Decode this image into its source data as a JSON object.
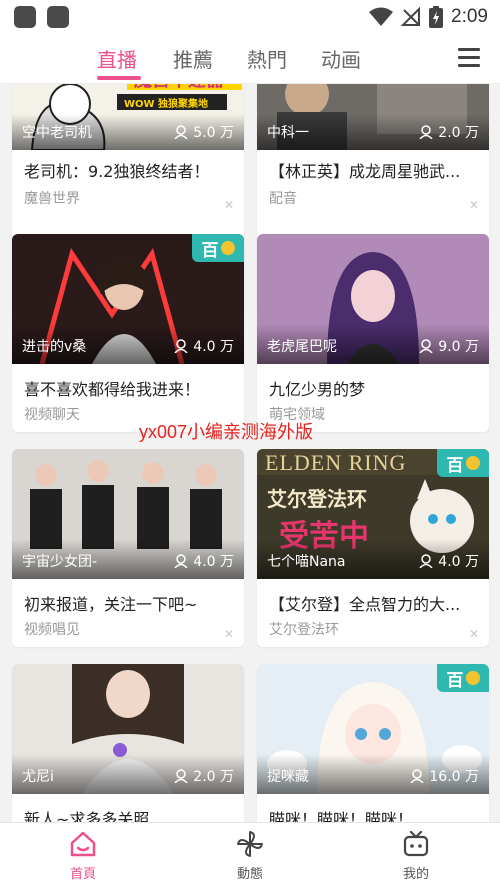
{
  "status_bar": {
    "time": "2:09"
  },
  "tabs": [
    {
      "label": "直播",
      "active": true
    },
    {
      "label": "推薦",
      "active": false
    },
    {
      "label": "熱門",
      "active": false
    },
    {
      "label": "动画",
      "active": false
    }
  ],
  "icons": {
    "menu": "menu-icon",
    "wifi": "wifi-icon",
    "signal": "no-signal-icon",
    "battery": "battery-charging-icon",
    "viewers": "person-icon",
    "close": "close-icon"
  },
  "colors": {
    "accent": "#ee4f8d",
    "badge": "#2fb8b0",
    "watermark": "#e8231d"
  },
  "cards": [
    {
      "streamer": "空中老司机",
      "viewers": "5.0 万",
      "title": "老司机：9.2独狼终结者！",
      "category": "魔兽世界",
      "badge": "",
      "overlay_text": "魔兽不速器",
      "overlay_sub": "WOW 独狼聚集地"
    },
    {
      "streamer": "中科一",
      "viewers": "2.0 万",
      "title": "【林正英】成龙周星驰武...",
      "category": "配音",
      "badge": ""
    },
    {
      "streamer": "进击的v桑",
      "viewers": "4.0 万",
      "title": "喜不喜欢都得给我进来！",
      "category": "视频聊天",
      "badge": "百"
    },
    {
      "streamer": "老虎尾巴呢",
      "viewers": "9.0 万",
      "title": "九亿少男的梦",
      "category": "萌宅领域",
      "badge": ""
    },
    {
      "streamer": "宇宙少女团-",
      "viewers": "4.0 万",
      "title": "初来报道，关注一下吧~",
      "category": "视频唱见",
      "badge": ""
    },
    {
      "streamer": "七个喵Nana",
      "viewers": "4.0 万",
      "title": "【艾尔登】全点智力的大...",
      "category": "艾尔登法环",
      "badge": "百",
      "overlay_text": "ELDEN RING",
      "overlay_sub": "艾尔登法环",
      "overlay_sub2": "受苦中"
    },
    {
      "streamer": "尤尼i",
      "viewers": "2.0 万",
      "title": "新人~求多多关照",
      "category": "",
      "badge": ""
    },
    {
      "streamer": "捉咪藏",
      "viewers": "16.0 万",
      "title": "瞄咪！瞄咪！瞄咪！",
      "category": "",
      "badge": "百"
    }
  ],
  "watermark": "yx007小编亲测海外版",
  "bottom_nav": [
    {
      "label": "首頁",
      "icon": "home-icon",
      "active": true
    },
    {
      "label": "動態",
      "icon": "pinwheel-icon",
      "active": false
    },
    {
      "label": "我的",
      "icon": "tv-face-icon",
      "active": false
    }
  ]
}
